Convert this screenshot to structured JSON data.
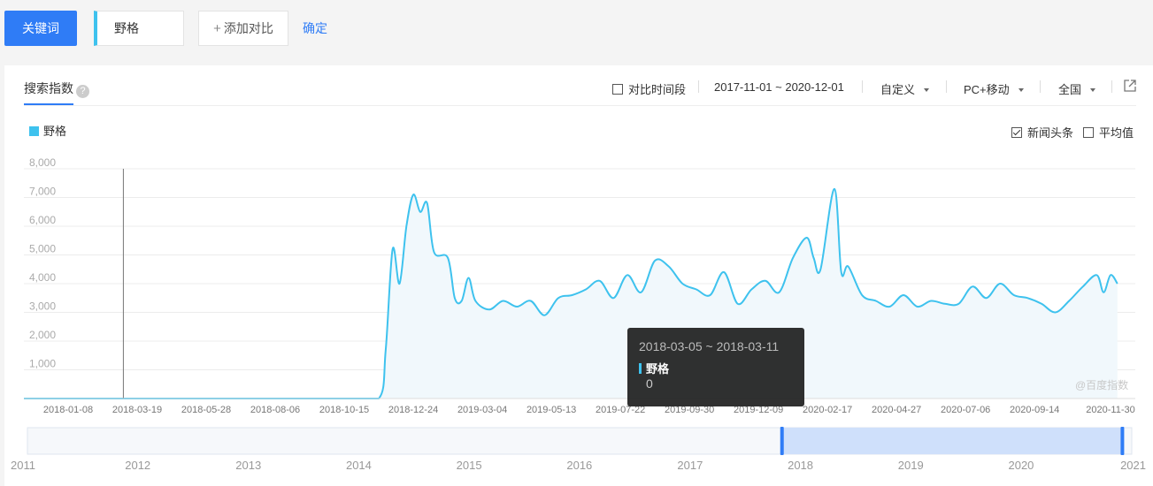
{
  "toolbar": {
    "keyword_button": "关键词",
    "keyword_value": "野格",
    "add_compare": "添加对比",
    "add_compare_icon": "plus-icon",
    "confirm": "确定"
  },
  "panel": {
    "tab_label": "搜索指数",
    "help_glyph": "?",
    "compare_period": "对比时间段",
    "date_range": "2017-11-01 ~ 2020-12-01",
    "custom": "自定义",
    "device": "PC+移动",
    "region": "全国",
    "export_icon": "external-link-icon",
    "news_headline": "新闻头条",
    "news_headline_checked": true,
    "average": "平均值",
    "average_checked": false
  },
  "tooltip": {
    "date": "2018-03-05 ~ 2018-03-11",
    "series": "野格",
    "value": "0"
  },
  "watermark": "@百度指数",
  "colors": {
    "accent": "#2f7cf6",
    "series": "#3ec2ee",
    "series_fill": "#f1f8fc"
  },
  "chart_data": {
    "type": "area",
    "title": "",
    "legend": [
      "野格"
    ],
    "legend_position": "top-left",
    "grid": true,
    "y_ticks": [
      "8,000",
      "7,000",
      "6,000",
      "5,000",
      "4,000",
      "3,000",
      "2,000",
      "1,000"
    ],
    "ylim": [
      0,
      8000
    ],
    "x_ticks": [
      "2018-01-08",
      "2018-03-19",
      "2018-05-28",
      "2018-08-06",
      "2018-10-15",
      "2018-12-24",
      "2019-03-04",
      "2019-05-13",
      "2019-07-22",
      "2019-09-30",
      "2019-12-09",
      "2020-02-17",
      "2020-04-27",
      "2020-07-06",
      "2020-09-14",
      "2020-11-30"
    ],
    "hover_date": "2018-03-05",
    "series": [
      {
        "name": "野格",
        "points": [
          [
            "2017-11-01",
            0
          ],
          [
            "2018-01-08",
            0
          ],
          [
            "2018-03-19",
            0
          ],
          [
            "2018-05-28",
            0
          ],
          [
            "2018-08-06",
            0
          ],
          [
            "2018-10-15",
            0
          ],
          [
            "2018-11-19",
            0
          ],
          [
            "2018-11-26",
            1700
          ],
          [
            "2018-12-03",
            5200
          ],
          [
            "2018-12-10",
            4000
          ],
          [
            "2018-12-17",
            6000
          ],
          [
            "2018-12-24",
            7100
          ],
          [
            "2018-12-31",
            6500
          ],
          [
            "2019-01-07",
            6800
          ],
          [
            "2019-01-14",
            5100
          ],
          [
            "2019-01-28",
            4900
          ],
          [
            "2019-02-04",
            3500
          ],
          [
            "2019-02-11",
            3400
          ],
          [
            "2019-02-18",
            4200
          ],
          [
            "2019-02-25",
            3400
          ],
          [
            "2019-03-11",
            3100
          ],
          [
            "2019-03-25",
            3400
          ],
          [
            "2019-04-08",
            3200
          ],
          [
            "2019-04-22",
            3400
          ],
          [
            "2019-05-06",
            2900
          ],
          [
            "2019-05-20",
            3500
          ],
          [
            "2019-06-03",
            3600
          ],
          [
            "2019-06-17",
            3800
          ],
          [
            "2019-07-01",
            4100
          ],
          [
            "2019-07-15",
            3500
          ],
          [
            "2019-07-29",
            4300
          ],
          [
            "2019-08-12",
            3700
          ],
          [
            "2019-08-26",
            4800
          ],
          [
            "2019-09-09",
            4600
          ],
          [
            "2019-09-23",
            4000
          ],
          [
            "2019-10-07",
            3800
          ],
          [
            "2019-10-21",
            3600
          ],
          [
            "2019-11-04",
            4400
          ],
          [
            "2019-11-18",
            3300
          ],
          [
            "2019-12-02",
            3800
          ],
          [
            "2019-12-16",
            4100
          ],
          [
            "2019-12-30",
            3700
          ],
          [
            "2020-01-13",
            4900
          ],
          [
            "2020-01-27",
            5600
          ],
          [
            "2020-02-03",
            4900
          ],
          [
            "2020-02-10",
            4500
          ],
          [
            "2020-02-24",
            7300
          ],
          [
            "2020-03-02",
            4400
          ],
          [
            "2020-03-09",
            4600
          ],
          [
            "2020-03-23",
            3600
          ],
          [
            "2020-04-06",
            3400
          ],
          [
            "2020-04-20",
            3200
          ],
          [
            "2020-05-04",
            3600
          ],
          [
            "2020-05-18",
            3200
          ],
          [
            "2020-06-01",
            3400
          ],
          [
            "2020-06-15",
            3300
          ],
          [
            "2020-06-29",
            3300
          ],
          [
            "2020-07-13",
            3900
          ],
          [
            "2020-07-27",
            3500
          ],
          [
            "2020-08-10",
            4000
          ],
          [
            "2020-08-24",
            3600
          ],
          [
            "2020-09-07",
            3500
          ],
          [
            "2020-09-21",
            3300
          ],
          [
            "2020-10-05",
            3000
          ],
          [
            "2020-10-19",
            3400
          ],
          [
            "2020-11-02",
            3900
          ],
          [
            "2020-11-16",
            4300
          ],
          [
            "2020-11-23",
            3700
          ],
          [
            "2020-11-30",
            4300
          ],
          [
            "2020-12-07",
            4000
          ]
        ]
      }
    ]
  },
  "timeline": {
    "years": [
      "2011",
      "2012",
      "2013",
      "2014",
      "2015",
      "2016",
      "2017",
      "2018",
      "2019",
      "2020",
      "2021"
    ],
    "selection_start": "2017-11-01",
    "selection_end": "2020-12-01"
  }
}
